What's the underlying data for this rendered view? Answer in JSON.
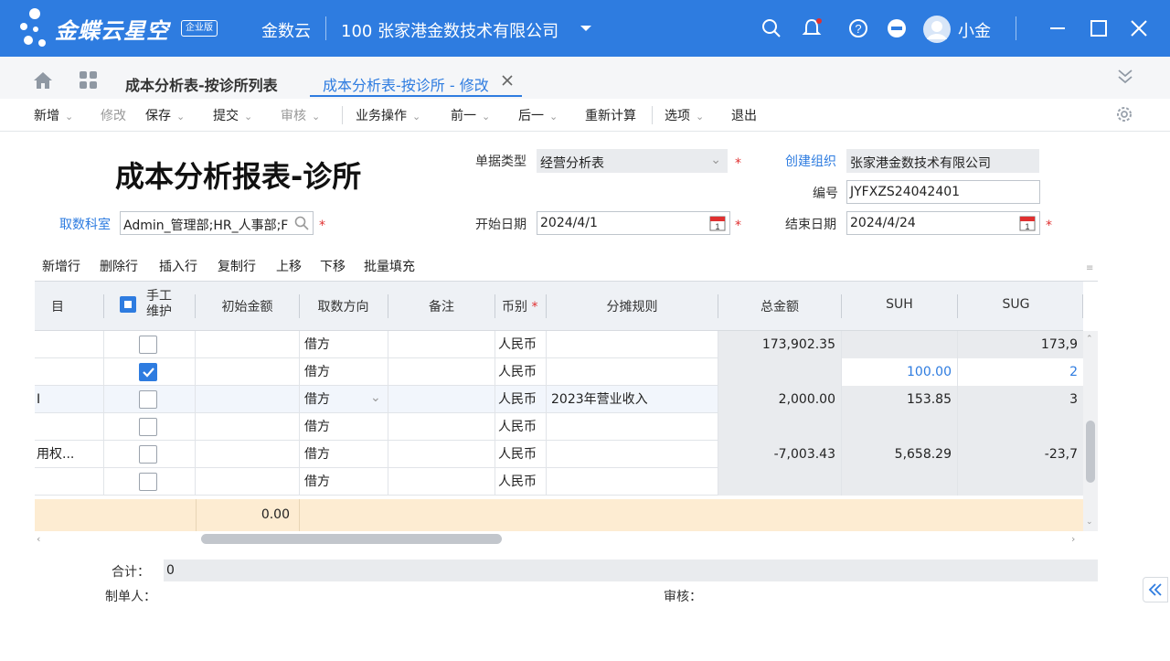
{
  "app": {
    "logo_name": "金蝶云",
    "logo_product": "星空",
    "logo_badge": "企业版",
    "service": "金数云",
    "company": "100  张家港金数技术有限公司",
    "user_name": "小金",
    "colors": {
      "primary": "#2e7ce0",
      "required": "#e03030",
      "sum_row": "#fdecd2"
    }
  },
  "tabs": [
    {
      "label": "成本分析表-按诊所列表"
    },
    {
      "label": "成本分析表-按诊所 - 修改"
    }
  ],
  "toolbar": {
    "add": "新增",
    "modify": "修改",
    "save": "保存",
    "submit": "提交",
    "audit": "审核",
    "business": "业务操作",
    "prev": "前一",
    "next": "后一",
    "recalc": "重新计算",
    "options": "选项",
    "exit": "退出"
  },
  "form": {
    "title": "成本分析报表-诊所",
    "doc_type_label": "单据类型",
    "doc_type_value": "经营分析表",
    "org_label": "创建组织",
    "org_value": "张家港金数技术有限公司",
    "number_label": "编号",
    "number_value": "JYFXZS24042401",
    "dept_label": "取数科室",
    "dept_value": "Admin_管理部;HR_人事部;F",
    "start_label": "开始日期",
    "start_value": "2024/4/1",
    "end_label": "结束日期",
    "end_value": "2024/4/24",
    "required_mark": "*"
  },
  "grid_toolbar": [
    "新增行",
    "删除行",
    "插入行",
    "复制行",
    "上移",
    "下移",
    "批量填充"
  ],
  "grid": {
    "headers": {
      "item": "目",
      "manual": "手工\n维护",
      "init_amount": "初始金额",
      "direction": "取数方向",
      "note": "备注",
      "currency": "币别",
      "alloc_rule": "分摊规则",
      "total": "总金额",
      "suh": "SUH",
      "sug": "SUG"
    },
    "rows": [
      {
        "item": "",
        "manual": false,
        "direction": "借方",
        "currency": "人民币",
        "rule": "",
        "total": "173,902.35",
        "suh": "",
        "sug": "173,9"
      },
      {
        "item": "",
        "manual": true,
        "direction": "借方",
        "currency": "人民币",
        "rule": "",
        "total": "",
        "suh": "100.00",
        "sug": "2"
      },
      {
        "item": "I",
        "manual": false,
        "direction": "借方",
        "currency": "人民币",
        "rule": "2023年营业收入",
        "total": "2,000.00",
        "suh": "153.85",
        "sug": "3"
      },
      {
        "item": "",
        "manual": false,
        "direction": "借方",
        "currency": "人民币",
        "rule": "",
        "total": "",
        "suh": "",
        "sug": ""
      },
      {
        "item": "用权...",
        "manual": false,
        "direction": "借方",
        "currency": "人民币",
        "rule": "",
        "total": "-7,003.43",
        "suh": "5,658.29",
        "sug": "-23,7"
      },
      {
        "item": "",
        "manual": false,
        "direction": "借方",
        "currency": "人民币",
        "rule": "",
        "total": "",
        "suh": "",
        "sug": ""
      }
    ],
    "sum_init_amount": "0.00"
  },
  "footer": {
    "total_label": "合计：",
    "total_value": "0",
    "creator_label": "制单人：",
    "auditor_label": "审核："
  }
}
